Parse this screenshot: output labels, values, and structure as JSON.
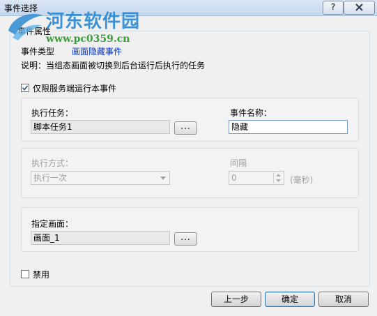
{
  "window": {
    "title": "事件选择",
    "help_label": "?"
  },
  "watermark": {
    "name": "河东软件园",
    "url": "www.pc0359.cn"
  },
  "group": {
    "label": "事件属性"
  },
  "event_type": {
    "label": "事件类型",
    "value": "画面隐藏事件"
  },
  "description": "说明：当组态画面被切换到后台运行后执行的任务",
  "server_only": {
    "label": "仅限服务端运行本事件",
    "checked": true
  },
  "task": {
    "label": "执行任务：",
    "value": "脚本任务1",
    "browse_label": "..."
  },
  "event_name": {
    "label": "事件名称：",
    "value": "隐藏"
  },
  "exec_mode": {
    "label": "执行方式：",
    "value": "执行一次"
  },
  "interval": {
    "label": "间隔",
    "value": "0",
    "unit": "(毫秒)"
  },
  "screen": {
    "label": "指定画面：",
    "value": "画面_1",
    "browse_label": "..."
  },
  "disable": {
    "label": "禁用",
    "checked": false
  },
  "buttons": {
    "prev": "上一步",
    "ok": "确定",
    "cancel": "取消"
  },
  "colors": {
    "link_blue": "#0033cc",
    "watermark_blue": "#2e8bd3",
    "watermark_green": "#3a9d3a"
  }
}
